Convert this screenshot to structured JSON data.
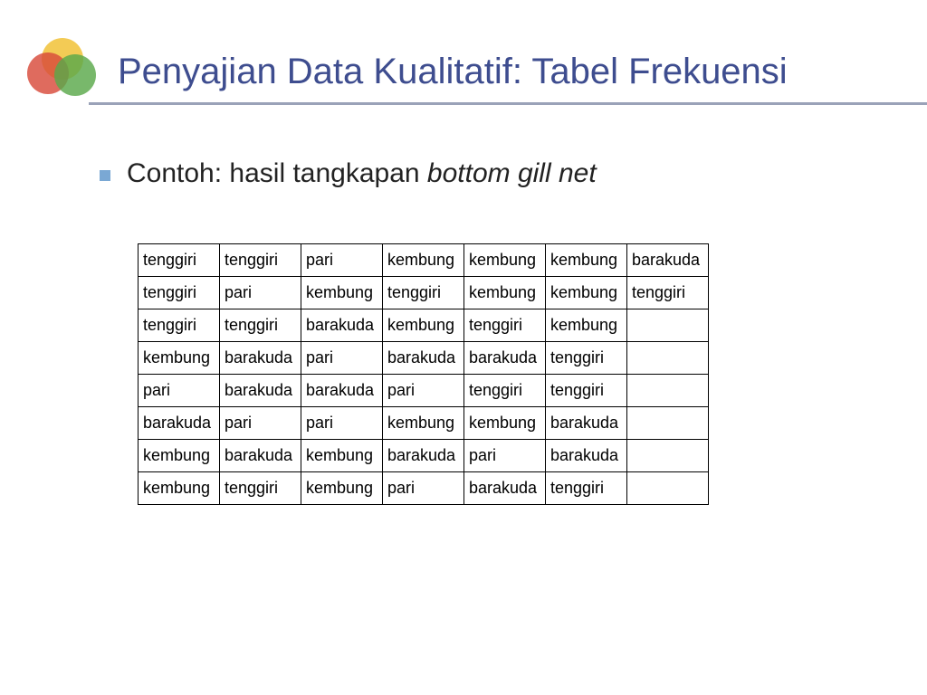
{
  "title": "Penyajian Data Kualitatif: Tabel Frekuensi",
  "bullet": {
    "prefix": "Contoh: hasil tangkapan ",
    "italic": "bottom gill net"
  },
  "table": {
    "rows": [
      [
        "tenggiri",
        "tenggiri",
        "pari",
        "kembung",
        "kembung",
        "kembung",
        "barakuda"
      ],
      [
        "tenggiri",
        "pari",
        "kembung",
        "tenggiri",
        "kembung",
        "kembung",
        "tenggiri"
      ],
      [
        "tenggiri",
        "tenggiri",
        "barakuda",
        "kembung",
        "tenggiri",
        "kembung",
        ""
      ],
      [
        "kembung",
        "barakuda",
        "pari",
        "barakuda",
        "barakuda",
        "tenggiri",
        ""
      ],
      [
        "pari",
        "barakuda",
        "barakuda",
        "pari",
        "tenggiri",
        "tenggiri",
        ""
      ],
      [
        "barakuda",
        "pari",
        "pari",
        "kembung",
        "kembung",
        "barakuda",
        ""
      ],
      [
        "kembung",
        "barakuda",
        "kembung",
        "barakuda",
        "pari",
        "barakuda",
        ""
      ],
      [
        "kembung",
        "tenggiri",
        "kembung",
        "pari",
        "barakuda",
        "tenggiri",
        ""
      ]
    ]
  }
}
